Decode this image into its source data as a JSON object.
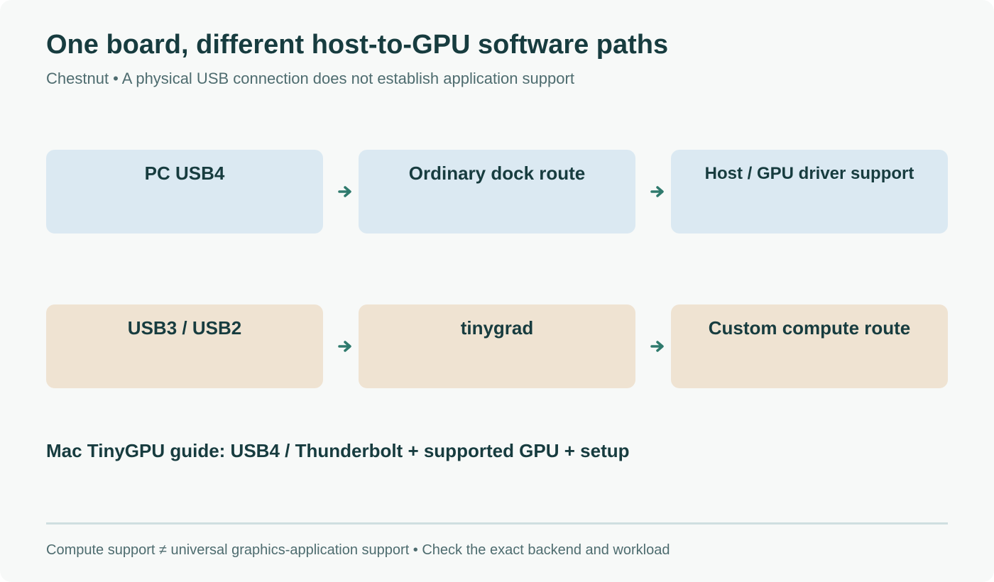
{
  "header": {
    "title": "One board, different host-to-GPU software paths",
    "subtitle": "Chestnut • A physical USB connection does not establish application support"
  },
  "rows": [
    {
      "color": "#dbe9f2",
      "boxes": [
        "PC USB4",
        "Ordinary dock route",
        "Host / GPU driver support"
      ]
    },
    {
      "color": "#efe3d2",
      "boxes": [
        "USB3 / USB2",
        "tinygrad",
        "Custom compute route"
      ]
    }
  ],
  "note": "Mac TinyGPU guide: USB4 / Thunderbolt + supported GPU + setup",
  "footer": "Compute support ≠ universal graphics-application support • Check the exact backend and workload",
  "colors": {
    "title": "#173c3f",
    "muted": "#4e6c6f",
    "arrow": "#2f7a6d",
    "divider": "#cfdfe0",
    "background": "#f7f9f8"
  }
}
